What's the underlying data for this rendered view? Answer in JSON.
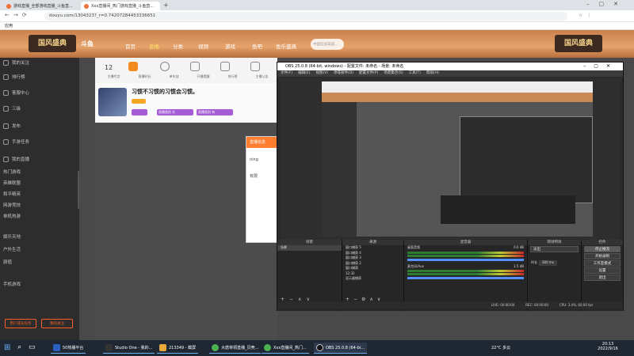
{
  "browser": {
    "tabs": [
      {
        "label": "游戏直播_全部游戏直播_斗鱼直..."
      },
      {
        "label": "Xxx直播间_热门游戏直播_斗鱼直..."
      }
    ],
    "url": "douyu.com/1304323?_r=0.74207284453336651",
    "bookmark": "应用"
  },
  "douyu": {
    "nav": [
      "首页",
      "直播",
      "分类",
      "视频",
      "游戏",
      "鱼吧",
      "鱼乐盛典"
    ],
    "search_placeholder": "中国征战美国...",
    "banner": "国风盛典"
  },
  "sidebar": {
    "items": [
      "我的关注",
      "排行榜",
      "客服中心",
      "三级",
      "发布",
      "手游任务",
      "我的直播",
      "热门游戏",
      "英雄联盟",
      "和平精英",
      "网游竞技",
      "单机热游",
      "娱乐天地",
      "户外生活",
      "颜值",
      "手机游戏"
    ],
    "bottom_buttons": [
      "用户成长任务",
      "我的关注"
    ]
  },
  "room": {
    "count": "12",
    "tabs": [
      "主播代言",
      "直播时长",
      "单车战",
      "开播提醒",
      "排行榜",
      "主播公告"
    ],
    "title": "习惯不习惯的习惯会习惯。",
    "tags": [
      "职业",
      "主播",
      "游戏"
    ],
    "badge1": "直播类别 头",
    "badge2": "直播类别 有"
  },
  "dialog": {
    "title": "直播信息",
    "line1": "ning",
    "line2": "有限"
  },
  "obs": {
    "title": "OBS 25.0.8 (64-bit, windows) - 配置文件: 未命名 - 场景: 未命名",
    "menu": [
      "文件(F)",
      "编辑(E)",
      "视图(V)",
      "停靠部件(D)",
      "配置文件(P)",
      "场景集合(S)",
      "工具(T)",
      "帮助(H)"
    ],
    "docks": {
      "scenes": "场景",
      "sources": "来源",
      "mixer": "混音器",
      "transitions": "转场特效",
      "controls": "控件"
    },
    "scenes": [
      "场景"
    ],
    "sources": [
      "窗口捕获 5",
      "窗口捕获 4",
      "窗口捕获 3",
      "窗口捕获 2",
      "窗口捕获",
      "12:32",
      "显示器捕获"
    ],
    "mixer": [
      {
        "name": "桌面音频",
        "db": "0.0 dB"
      },
      {
        "name": "麦克风/Aux",
        "db": "1.5 dB"
      }
    ],
    "transition": {
      "type": "淡出",
      "duration_label": "时长",
      "duration": "300 ms"
    },
    "controls": [
      "停止推流",
      "开始录制",
      "工作室模式",
      "设置",
      "退出"
    ],
    "status": {
      "live": "LIVE: 00:00:00",
      "rec": "REC: 00:00:00",
      "cpu": "CPU: 3.4%, 60.00 fps"
    }
  },
  "taskbar": {
    "items": [
      "50热播平台",
      "Studio One - 我的...",
      "213349 - 截屏",
      "大唐将领直播_贝壳...",
      "Xxx直播间_热门...",
      "OBS 25.0.8 (64-bi..."
    ],
    "weather": "22°C 多云",
    "time": "20:13",
    "date": "2022/9/16"
  },
  "colors": {
    "douyu_orange": "#ff7700",
    "obs_bg": "#2b2b2b",
    "taskbar": "#1f2733"
  }
}
